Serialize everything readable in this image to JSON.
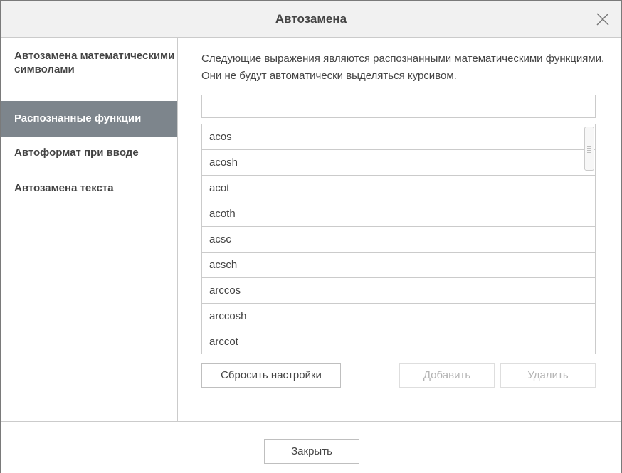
{
  "dialog": {
    "title": "Автозамена",
    "close_icon": "close-x-icon"
  },
  "sidebar": {
    "items": [
      {
        "label": "Автозамена математическими символами",
        "active": false
      },
      {
        "label": "Распознанные функции",
        "active": true
      },
      {
        "label": "Автоформат при вводе",
        "active": false
      },
      {
        "label": "Автозамена текста",
        "active": false
      }
    ]
  },
  "main": {
    "description": "Следующие выражения являются распознанными математическими функциями. Они не будут автоматически выделяться курсивом.",
    "search": {
      "value": "",
      "placeholder": ""
    },
    "functions": [
      "acos",
      "acosh",
      "acot",
      "acoth",
      "acsc",
      "acsch",
      "arccos",
      "arccosh",
      "arccot"
    ],
    "reset_label": "Сбросить настройки",
    "add_label": "Добавить",
    "delete_label": "Удалить"
  },
  "footer": {
    "close_label": "Закрыть"
  },
  "colors": {
    "active_nav_bg": "#7d858c",
    "border": "#cbcbcb",
    "text": "#444444",
    "disabled_text": "#b3b3b3"
  }
}
